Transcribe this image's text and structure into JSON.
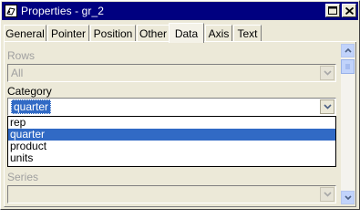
{
  "window": {
    "title": "Properties - gr_2",
    "icon": "properties-app-icon"
  },
  "tabs": [
    {
      "label": "General",
      "active": false
    },
    {
      "label": "Pointer",
      "active": false
    },
    {
      "label": "Position",
      "active": false
    },
    {
      "label": "Other",
      "active": false
    },
    {
      "label": "Data",
      "active": true
    },
    {
      "label": "Axis",
      "active": false
    },
    {
      "label": "Text",
      "active": false
    }
  ],
  "rows": {
    "label": "Rows",
    "value": "All",
    "enabled": false
  },
  "category": {
    "label": "Category",
    "value": "quarter",
    "options": [
      "rep",
      "quarter",
      "product",
      "units"
    ],
    "selected_index": 1
  },
  "series": {
    "label": "Series",
    "value": "",
    "enabled": false
  },
  "colors": {
    "titlebar": "#000080",
    "selection": "#316ac5",
    "face": "#ece9d8"
  }
}
